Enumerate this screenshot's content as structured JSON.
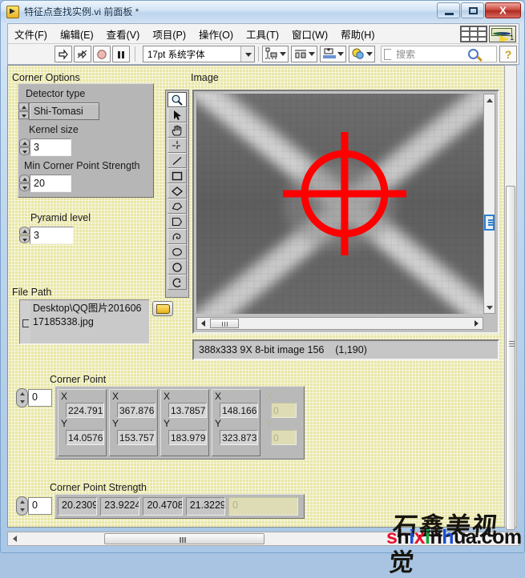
{
  "window": {
    "title": "特征点查找实例.vi 前面板 *",
    "app_icon": "labview-vi-icon",
    "buttons": {
      "minimize": "–",
      "maximize": "□",
      "close": "X"
    }
  },
  "menubar": {
    "items": [
      {
        "label": "文件(F)",
        "name": "menu-file"
      },
      {
        "label": "编辑(E)",
        "name": "menu-edit"
      },
      {
        "label": "查看(V)",
        "name": "menu-view"
      },
      {
        "label": "项目(P)",
        "name": "menu-project"
      },
      {
        "label": "操作(O)",
        "name": "menu-operate"
      },
      {
        "label": "工具(T)",
        "name": "menu-tools"
      },
      {
        "label": "窗口(W)",
        "name": "menu-window"
      },
      {
        "label": "帮助(H)",
        "name": "menu-help"
      }
    ],
    "vi_badge_number": "1"
  },
  "toolbar": {
    "run_icon": "run-arrow-icon",
    "run_continuous_icon": "run-continuous-icon",
    "abort_icon": "abort-stop-icon",
    "pause_icon": "pause-icon",
    "font_selector": "17pt 系统字体",
    "align_icon": "align-objects-icon",
    "distribute_icon": "distribute-objects-icon",
    "resize_icon": "resize-objects-icon",
    "reorder_icon": "reorder-objects-icon",
    "search_placeholder": "搜索",
    "search_value": "",
    "help_icon": "context-help-icon"
  },
  "panel": {
    "corner_options": {
      "group_label": "Corner Options",
      "detector_type": {
        "label": "Detector type",
        "value": "Shi-Tomasi"
      },
      "kernel_size": {
        "label": "Kernel size",
        "value": "3"
      },
      "min_corner_point_strength": {
        "label": "Min Corner Point Strength",
        "value": "20"
      }
    },
    "pyramid_level": {
      "label": "Pyramid level",
      "value": "3"
    },
    "file_path": {
      "label": "File Path",
      "value": "Desktop\\QQ图片20160617185338.jpg",
      "browse_icon": "folder-browse-icon"
    },
    "image": {
      "label": "Image",
      "status_text": "388x333 9X 8-bit image 156    (1,190)",
      "overlay": "red-crosshair-marker",
      "tools": [
        {
          "name": "tool-zoom",
          "icon": "magnifier-icon",
          "selected": true
        },
        {
          "name": "tool-select",
          "icon": "arrow-pointer-icon",
          "selected": false
        },
        {
          "name": "tool-pan",
          "icon": "hand-pan-icon",
          "selected": false
        },
        {
          "name": "tool-point",
          "icon": "point-crosshair-icon",
          "selected": false
        },
        {
          "name": "tool-line",
          "icon": "line-icon",
          "selected": false
        },
        {
          "name": "tool-rectangle",
          "icon": "rectangle-icon",
          "selected": false
        },
        {
          "name": "tool-rotated-rectangle",
          "icon": "diamond-icon",
          "selected": false
        },
        {
          "name": "tool-polygon",
          "icon": "polygon-icon",
          "selected": false
        },
        {
          "name": "tool-broken-line",
          "icon": "broken-line-icon",
          "selected": false
        },
        {
          "name": "tool-freehand-line",
          "icon": "freehand-line-icon",
          "selected": false
        },
        {
          "name": "tool-freehand-region",
          "icon": "freehand-region-icon",
          "selected": false
        },
        {
          "name": "tool-oval",
          "icon": "oval-icon",
          "selected": false
        },
        {
          "name": "tool-annulus",
          "icon": "annulus-icon",
          "selected": false
        }
      ]
    },
    "corner_point": {
      "label": "Corner Point",
      "index_value": "0",
      "x_label": "X",
      "y_label": "Y",
      "elements": [
        {
          "x": "224.791",
          "y": "14.0576",
          "empty": false
        },
        {
          "x": "367.876",
          "y": "153.757",
          "empty": false
        },
        {
          "x": "13.7857",
          "y": "183.979",
          "empty": false
        },
        {
          "x": "148.166",
          "y": "323.873",
          "empty": false
        },
        {
          "x": "0",
          "y": "0",
          "empty": true
        }
      ]
    },
    "corner_point_strength": {
      "label": "Corner Point Strength",
      "index_value": "0",
      "values": [
        "20.2309",
        "23.9224",
        "20.4708",
        "21.3229"
      ],
      "empty_value": "0"
    }
  },
  "watermark": {
    "chinese": "石鑫美视觉",
    "domain_parts": [
      {
        "t": "s",
        "c": "red"
      },
      {
        "t": "h",
        "c": "black"
      },
      {
        "t": "i",
        "c": "blue"
      },
      {
        "t": "x",
        "c": "red"
      },
      {
        "t": "i",
        "c": "green"
      },
      {
        "t": "n",
        "c": "black"
      },
      {
        "t": "h",
        "c": "blue"
      },
      {
        "t": "u",
        "c": "black"
      },
      {
        "t": "a",
        "c": "black"
      },
      {
        "t": ".com",
        "c": "black"
      }
    ]
  },
  "colors": {
    "panel_background": "#e9e7a8",
    "overlay_red": "#ff0000",
    "accent_blue": "#2f7fd0"
  }
}
